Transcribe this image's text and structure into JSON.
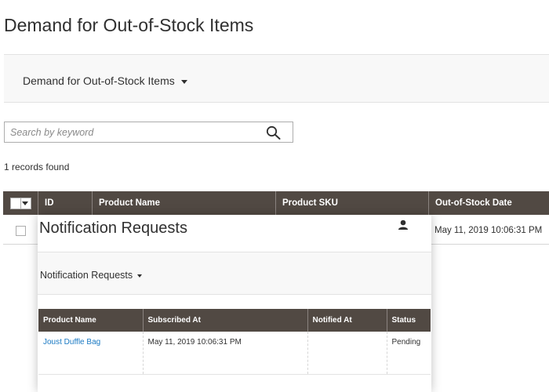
{
  "page": {
    "title": "Demand for Out-of-Stock Items"
  },
  "scope": {
    "label": "Demand for Out-of-Stock Items"
  },
  "search": {
    "placeholder": "Search by keyword",
    "value": ""
  },
  "records_found": "1 records found",
  "grid": {
    "columns": [
      "ID",
      "Product Name",
      "Product SKU",
      "Out-of-Stock Date"
    ],
    "rows": [
      {
        "date": "May 11, 2019 10:06:31 PM"
      }
    ]
  },
  "modal": {
    "title": "Notification Requests",
    "scope_label": "Notification Requests",
    "columns": [
      "Product Name",
      "Subscribed At",
      "Notified At",
      "Status"
    ],
    "rows": [
      {
        "product": "Joust Duffle Bag",
        "subscribed_at": "May 11, 2019 10:06:31 PM",
        "notified_at": "",
        "status": "Pending"
      }
    ]
  },
  "colors": {
    "header_bg": "#514943",
    "link": "#1979c3",
    "scope_bg": "#f8f8f8"
  },
  "icons": {
    "search": "search-icon",
    "user": "user-icon",
    "caret": "caret-down-icon"
  }
}
